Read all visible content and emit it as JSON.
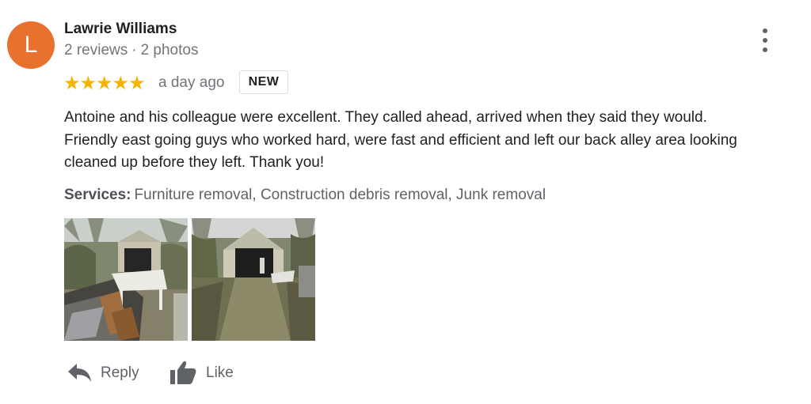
{
  "reviewer": {
    "avatar_letter": "L",
    "avatar_color": "#e8712e",
    "name": "Lawrie Williams",
    "reviews": "2 reviews",
    "separator": "·",
    "photos": "2 photos"
  },
  "rating": {
    "stars": 5,
    "stars_text": "★★★★★",
    "star_color": "#f4b400",
    "time": "a day ago",
    "badge": "NEW"
  },
  "review_text": {
    "line1": "Antoine and his colleague were excellent.  They called ahead, arrived when they said they would.",
    "line2": "Friendly east going guys who worked hard, were fast and efficient and left our back alley area looking",
    "line3": "cleaned up before they left. Thank you!"
  },
  "services": {
    "label": "Services:",
    "value": "Furniture removal, Construction debris removal, Junk removal"
  },
  "photos": [
    {
      "icon": "photo-garage-debris"
    },
    {
      "icon": "photo-garage-cleaned"
    }
  ],
  "actions": {
    "reply": {
      "label": "Reply",
      "icon": "reply-arrow-icon"
    },
    "like": {
      "label": "Like",
      "icon": "thumbs-up-icon"
    }
  },
  "menu": {
    "icon": "more-vertical-icon"
  }
}
